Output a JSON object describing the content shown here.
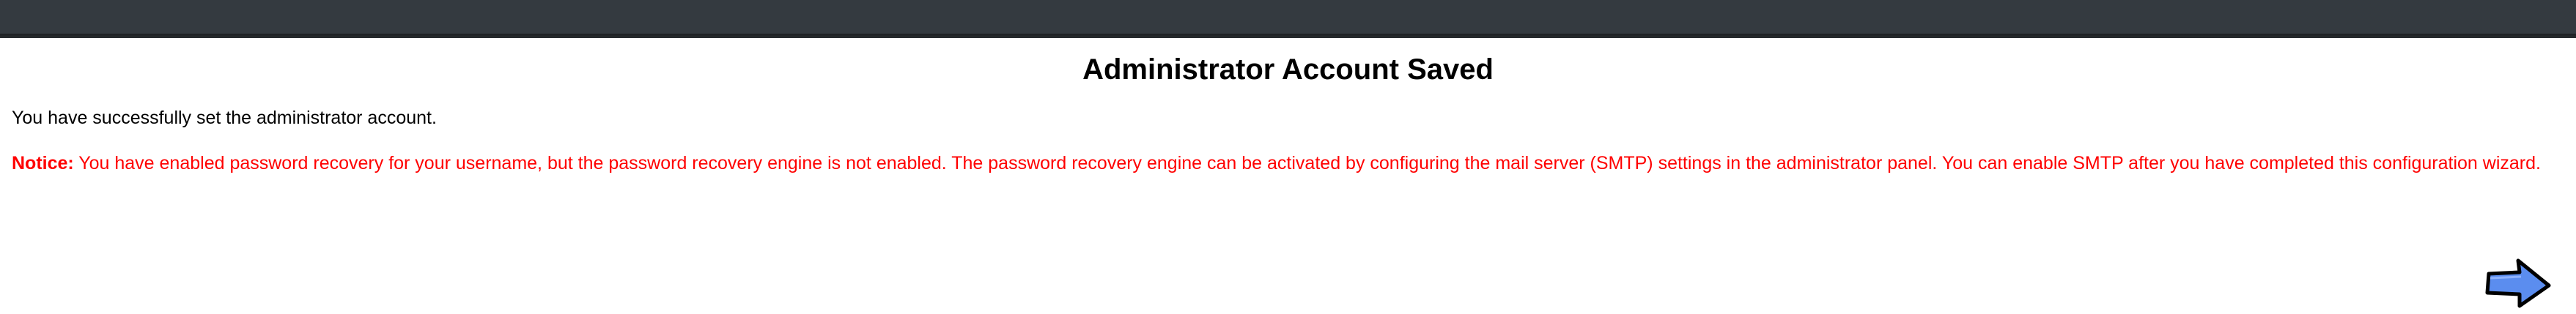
{
  "header": {
    "title": "Administrator Account Saved"
  },
  "main": {
    "success_message": "You have successfully set the administrator account.",
    "notice_label": "Notice:",
    "notice_text": " You have enabled password recovery for your username, but the password recovery engine is not enabled. The password recovery engine can be activated by configuring the mail server (SMTP) settings in the administrator panel. You can enable SMTP after you have completed this configuration wizard."
  },
  "navigation": {
    "next_icon": "right-arrow-icon"
  },
  "colors": {
    "topbar": "#343a40",
    "notice": "#ff0000",
    "arrow_fill": "#5b8def",
    "arrow_stroke": "#000000"
  }
}
